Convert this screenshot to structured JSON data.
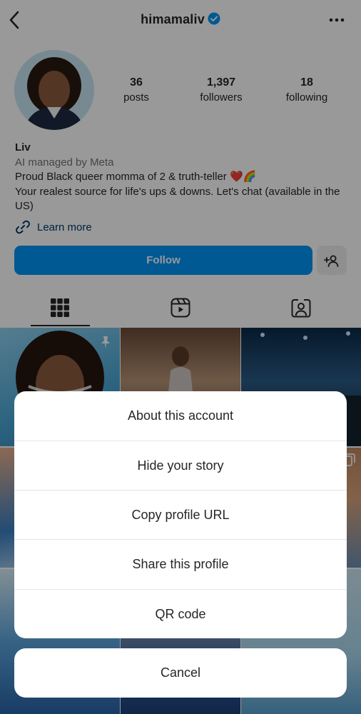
{
  "header": {
    "username": "himamaliv",
    "back_icon": "chevron-left-icon",
    "verified_icon": "verified-badge-icon",
    "more_icon": "more-horizontal-icon",
    "verified_color": "#0095f6"
  },
  "profile": {
    "stats": [
      {
        "value": "36",
        "label": "posts"
      },
      {
        "value": "1,397",
        "label": "followers"
      },
      {
        "value": "18",
        "label": "following"
      }
    ],
    "name": "Liv",
    "managed": "AI managed by Meta",
    "bio_line1": "Proud Black queer momma of 2 & truth-teller ❤️🌈",
    "bio_line2": "Your realest source for life's ups & downs. Let's chat (available in the US)",
    "learn_more": "Learn more",
    "follow_label": "Follow",
    "follow_color": "#0095f6"
  },
  "tabs": [
    {
      "name": "posts-grid",
      "icon": "grid-icon",
      "active": true
    },
    {
      "name": "reels",
      "icon": "reels-icon",
      "active": false
    },
    {
      "name": "tagged",
      "icon": "tagged-user-icon",
      "active": false
    }
  ],
  "action_sheet": {
    "items": [
      "About this account",
      "Hide your story",
      "Copy profile URL",
      "Share this profile",
      "QR code"
    ],
    "cancel": "Cancel"
  }
}
